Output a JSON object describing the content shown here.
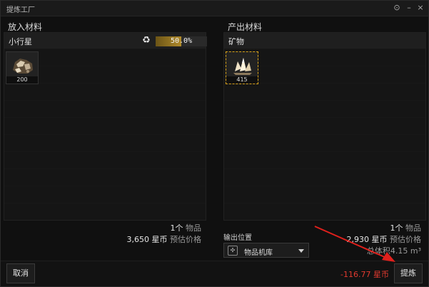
{
  "window": {
    "title": "提炼工厂"
  },
  "window_controls": {
    "settings": "⊙",
    "minimize": "–",
    "close": "×"
  },
  "input": {
    "section_label": "放入材料",
    "panel_label": "小行星",
    "progress_text": "50.0%",
    "progress_fraction": 0.5,
    "item": {
      "icon": "asteroid-ore-icon",
      "quantity": "200"
    },
    "count_num": "1个",
    "count_unit": "物品",
    "price_num": "3,650 星币",
    "price_unit": "预估价格"
  },
  "output": {
    "section_label": "产出材料",
    "panel_label": "矿物",
    "item": {
      "icon": "mineral-crystal-icon",
      "quantity": "415"
    },
    "count_num": "1个",
    "count_unit": "物品",
    "price_num": "2,930 星币",
    "price_unit": "预估价格",
    "volume": "总体积4.15 m³",
    "location_label": "输出位置",
    "location_value": "物品机库"
  },
  "footer": {
    "cancel_label": "取消",
    "cost": "-116.77 星币",
    "refine_label": "提炼"
  },
  "colors": {
    "accent": "#b08a2a",
    "cost": "#e23a2f",
    "selected_border": "#d7a21b",
    "arrow": "#e0201c"
  }
}
